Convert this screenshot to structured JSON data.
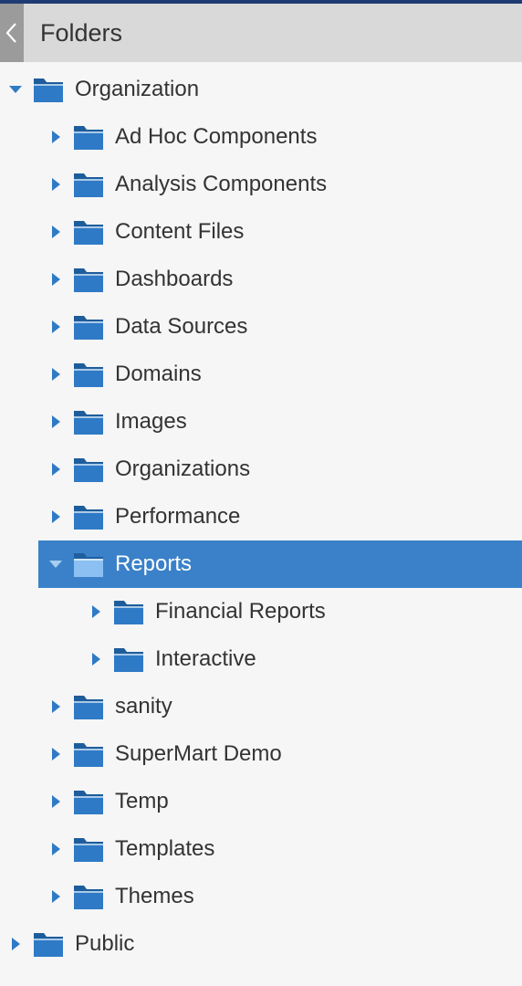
{
  "header": {
    "title": "Folders",
    "collapse_icon": "chevron-left-icon"
  },
  "colors": {
    "folder": "#2f7ac6",
    "folder_selected": "#8cc0f2",
    "selection": "#3a81c9",
    "arrow": "#2f7ac6"
  },
  "tree": [
    {
      "label": "Organization",
      "depth": 0,
      "expanded": true,
      "selected": false,
      "icon": "folder-icon",
      "toggle_icon": "caret-down-icon"
    },
    {
      "label": "Ad Hoc Components",
      "depth": 1,
      "expanded": false,
      "selected": false,
      "icon": "folder-icon",
      "toggle_icon": "caret-right-icon"
    },
    {
      "label": "Analysis Components",
      "depth": 1,
      "expanded": false,
      "selected": false,
      "icon": "folder-icon",
      "toggle_icon": "caret-right-icon"
    },
    {
      "label": "Content Files",
      "depth": 1,
      "expanded": false,
      "selected": false,
      "icon": "folder-icon",
      "toggle_icon": "caret-right-icon"
    },
    {
      "label": "Dashboards",
      "depth": 1,
      "expanded": false,
      "selected": false,
      "icon": "folder-icon",
      "toggle_icon": "caret-right-icon"
    },
    {
      "label": "Data Sources",
      "depth": 1,
      "expanded": false,
      "selected": false,
      "icon": "folder-icon",
      "toggle_icon": "caret-right-icon"
    },
    {
      "label": "Domains",
      "depth": 1,
      "expanded": false,
      "selected": false,
      "icon": "folder-icon",
      "toggle_icon": "caret-right-icon"
    },
    {
      "label": "Images",
      "depth": 1,
      "expanded": false,
      "selected": false,
      "icon": "folder-icon",
      "toggle_icon": "caret-right-icon"
    },
    {
      "label": "Organizations",
      "depth": 1,
      "expanded": false,
      "selected": false,
      "icon": "folder-icon",
      "toggle_icon": "caret-right-icon"
    },
    {
      "label": "Performance",
      "depth": 1,
      "expanded": false,
      "selected": false,
      "icon": "folder-icon",
      "toggle_icon": "caret-right-icon"
    },
    {
      "label": "Reports",
      "depth": 1,
      "expanded": true,
      "selected": true,
      "icon": "folder-icon",
      "toggle_icon": "caret-down-icon"
    },
    {
      "label": "Financial Reports",
      "depth": 2,
      "expanded": false,
      "selected": false,
      "icon": "folder-icon",
      "toggle_icon": "caret-right-icon"
    },
    {
      "label": "Interactive",
      "depth": 2,
      "expanded": false,
      "selected": false,
      "icon": "folder-icon",
      "toggle_icon": "caret-right-icon"
    },
    {
      "label": "sanity",
      "depth": 1,
      "expanded": false,
      "selected": false,
      "icon": "folder-icon",
      "toggle_icon": "caret-right-icon"
    },
    {
      "label": "SuperMart Demo",
      "depth": 1,
      "expanded": false,
      "selected": false,
      "icon": "folder-icon",
      "toggle_icon": "caret-right-icon"
    },
    {
      "label": "Temp",
      "depth": 1,
      "expanded": false,
      "selected": false,
      "icon": "folder-icon",
      "toggle_icon": "caret-right-icon"
    },
    {
      "label": "Templates",
      "depth": 1,
      "expanded": false,
      "selected": false,
      "icon": "folder-icon",
      "toggle_icon": "caret-right-icon"
    },
    {
      "label": "Themes",
      "depth": 1,
      "expanded": false,
      "selected": false,
      "icon": "folder-icon",
      "toggle_icon": "caret-right-icon"
    },
    {
      "label": "Public",
      "depth": 0,
      "expanded": false,
      "selected": false,
      "icon": "folder-icon",
      "toggle_icon": "caret-right-icon"
    }
  ]
}
